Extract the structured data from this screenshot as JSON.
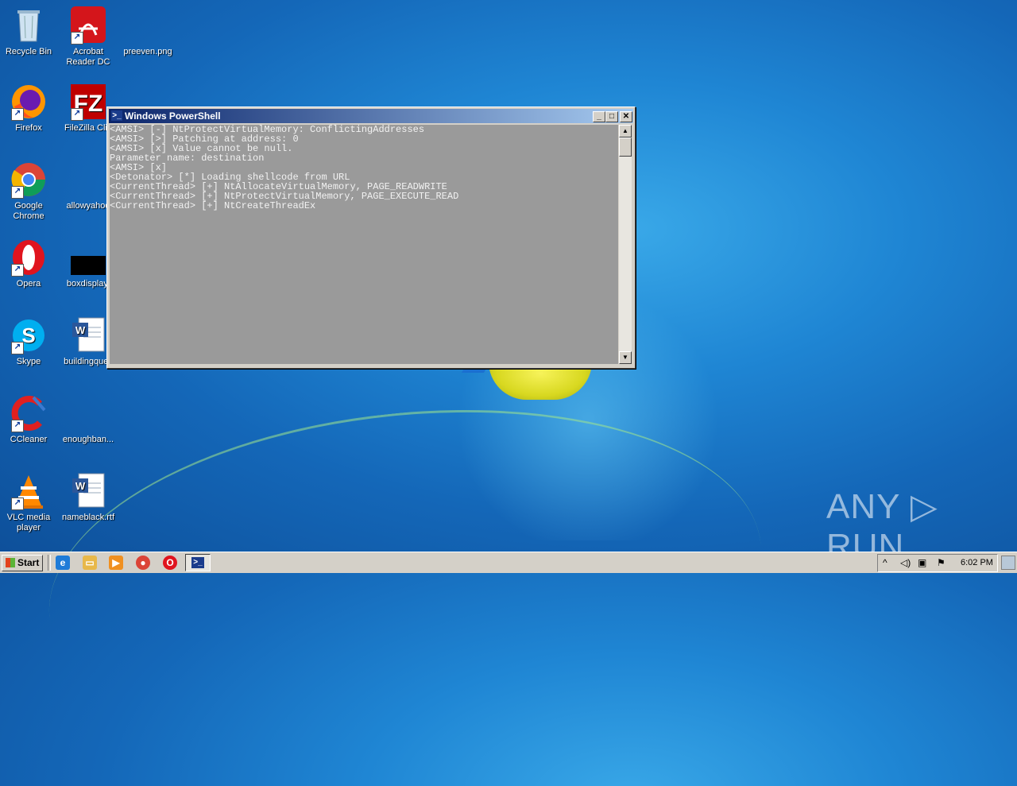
{
  "desktop": {
    "icons": [
      {
        "label": "Recycle Bin"
      },
      {
        "label": "Acrobat Reader DC"
      },
      {
        "label": "preeven.png"
      },
      {
        "label": "Firefox"
      },
      {
        "label": "FileZilla Clie"
      },
      {
        "label": "Google Chrome"
      },
      {
        "label": "allowyahoo"
      },
      {
        "label": "Opera"
      },
      {
        "label": "boxdisplay."
      },
      {
        "label": "Skype"
      },
      {
        "label": "buildingques"
      },
      {
        "label": "CCleaner"
      },
      {
        "label": "enoughban..."
      },
      {
        "label": "VLC media player"
      },
      {
        "label": "nameblack.rtf"
      }
    ],
    "watermark": "ANY ▷ RUN"
  },
  "window": {
    "title": "Windows PowerShell",
    "buttons": {
      "minimize": "_",
      "maximize": "□",
      "close": "✕"
    },
    "console_lines": [
      "<AMSI> [-] NtProtectVirtualMemory: ConflictingAddresses",
      "<AMSI> [>] Patching at address: 0",
      "<AMSI> [x] Value cannot be null.",
      "Parameter name: destination",
      "<AMSI> [x]",
      "<Detonator> [*] Loading shellcode from URL",
      "<CurrentThread> [+] NtAllocateVirtualMemory, PAGE_READWRITE",
      "<CurrentThread> [+] NtProtectVirtualMemory, PAGE_EXECUTE_READ",
      "<CurrentThread> [+] NtCreateThreadEx"
    ],
    "scroll": {
      "up": "▲",
      "down": "▼"
    }
  },
  "taskbar": {
    "start_label": "Start",
    "clock": "6:02 PM",
    "tray_icons": [
      "chevron-up-icon",
      "speaker-icon",
      "network-icon",
      "flag-icon"
    ],
    "quick_launch": [
      "internet-explorer-icon",
      "explorer-folder-icon",
      "media-player-icon",
      "chrome-icon",
      "opera-icon"
    ],
    "active_task": "powershell-icon"
  }
}
